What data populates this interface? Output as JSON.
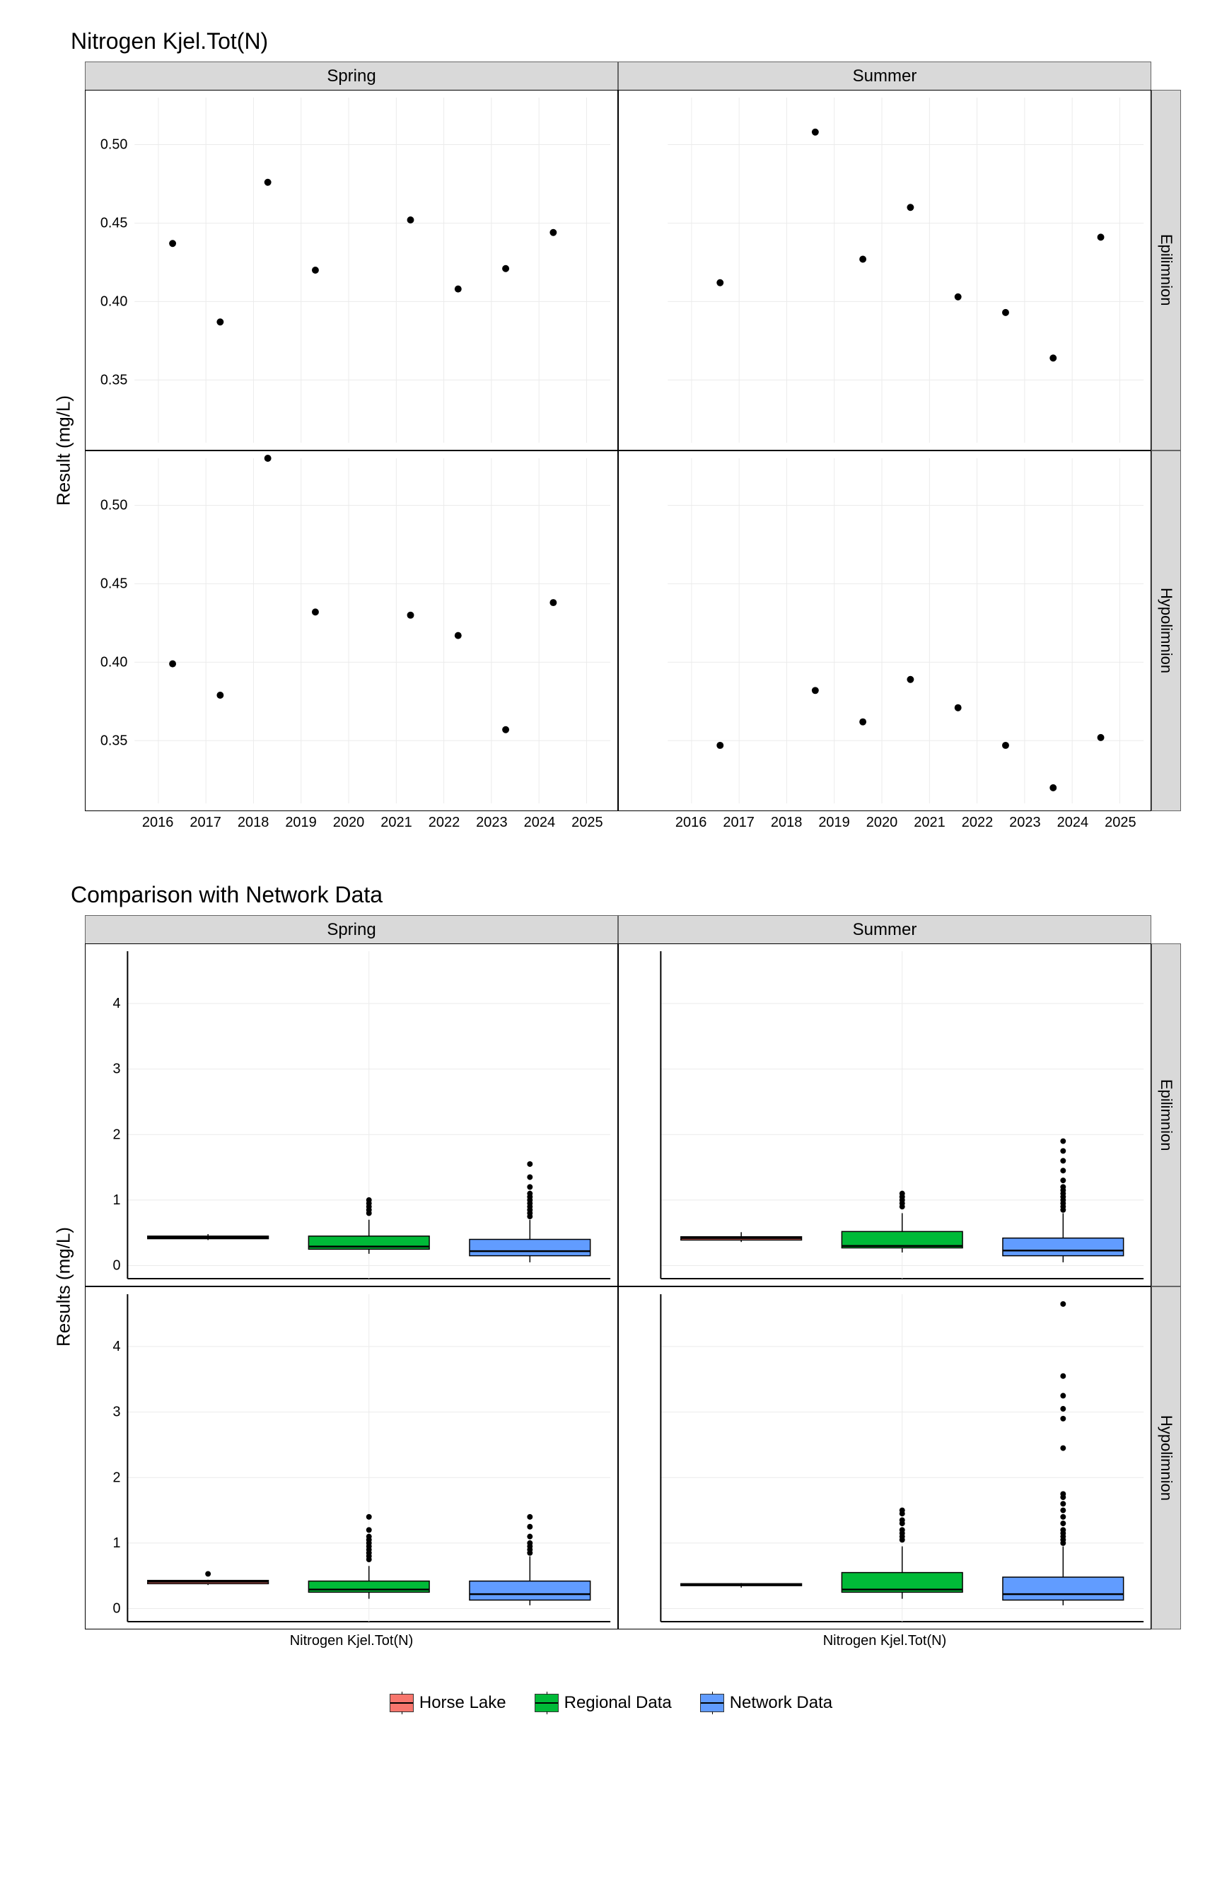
{
  "chart_data": [
    {
      "type": "scatter",
      "title": "Nitrogen Kjel.Tot(N)",
      "ylabel": "Result (mg/L)",
      "xlabel": "",
      "x_range": [
        2015.5,
        2025.5
      ],
      "y_range": [
        0.31,
        0.53
      ],
      "x_ticks": [
        2016,
        2017,
        2018,
        2019,
        2020,
        2021,
        2022,
        2023,
        2024,
        2025
      ],
      "y_ticks": [
        0.35,
        0.4,
        0.45,
        0.5
      ],
      "col_facets": [
        "Spring",
        "Summer"
      ],
      "row_facets": [
        "Epilimnion",
        "Hypolimnion"
      ],
      "panels": {
        "Spring_Epilimnion": [
          {
            "x": 2016.3,
            "y": 0.437
          },
          {
            "x": 2017.3,
            "y": 0.387
          },
          {
            "x": 2018.3,
            "y": 0.476
          },
          {
            "x": 2019.3,
            "y": 0.42
          },
          {
            "x": 2021.3,
            "y": 0.452
          },
          {
            "x": 2022.3,
            "y": 0.408
          },
          {
            "x": 2023.3,
            "y": 0.421
          },
          {
            "x": 2024.3,
            "y": 0.444
          }
        ],
        "Summer_Epilimnion": [
          {
            "x": 2016.6,
            "y": 0.412
          },
          {
            "x": 2018.6,
            "y": 0.508
          },
          {
            "x": 2019.6,
            "y": 0.427
          },
          {
            "x": 2020.6,
            "y": 0.46
          },
          {
            "x": 2021.6,
            "y": 0.403
          },
          {
            "x": 2022.6,
            "y": 0.393
          },
          {
            "x": 2023.6,
            "y": 0.364
          },
          {
            "x": 2024.6,
            "y": 0.441
          }
        ],
        "Spring_Hypolimnion": [
          {
            "x": 2016.3,
            "y": 0.399
          },
          {
            "x": 2017.3,
            "y": 0.379
          },
          {
            "x": 2018.3,
            "y": 0.53
          },
          {
            "x": 2019.3,
            "y": 0.432
          },
          {
            "x": 2021.3,
            "y": 0.43
          },
          {
            "x": 2022.3,
            "y": 0.417
          },
          {
            "x": 2023.3,
            "y": 0.357
          },
          {
            "x": 2024.3,
            "y": 0.438
          }
        ],
        "Summer_Hypolimnion": [
          {
            "x": 2016.6,
            "y": 0.347
          },
          {
            "x": 2018.6,
            "y": 0.382
          },
          {
            "x": 2019.6,
            "y": 0.362
          },
          {
            "x": 2020.6,
            "y": 0.389
          },
          {
            "x": 2021.6,
            "y": 0.371
          },
          {
            "x": 2022.6,
            "y": 0.347
          },
          {
            "x": 2023.6,
            "y": 0.32
          },
          {
            "x": 2024.6,
            "y": 0.352
          }
        ]
      }
    },
    {
      "type": "boxplot",
      "title": "Comparison with Network Data",
      "ylabel": "Results (mg/L)",
      "xlabel": "Nitrogen Kjel.Tot(N)",
      "y_range": [
        -0.2,
        4.8
      ],
      "y_ticks": [
        0,
        1,
        2,
        3,
        4
      ],
      "col_facets": [
        "Spring",
        "Summer"
      ],
      "row_facets": [
        "Epilimnion",
        "Hypolimnion"
      ],
      "groups": [
        "Horse Lake",
        "Regional Data",
        "Network Data"
      ],
      "colors": {
        "Horse Lake": "#F8766D",
        "Regional Data": "#00BA38",
        "Network Data": "#619CFF"
      },
      "panels": {
        "Spring_Epilimnion": {
          "boxes": [
            {
              "g": "Horse Lake",
              "min": 0.39,
              "q1": 0.41,
              "med": 0.43,
              "q3": 0.45,
              "max": 0.48,
              "out": []
            },
            {
              "g": "Regional Data",
              "min": 0.18,
              "q1": 0.25,
              "med": 0.29,
              "q3": 0.45,
              "max": 0.7,
              "out": [
                0.8,
                0.85,
                0.9,
                0.95,
                1.0
              ]
            },
            {
              "g": "Network Data",
              "min": 0.05,
              "q1": 0.15,
              "med": 0.22,
              "q3": 0.4,
              "max": 0.7,
              "out": [
                0.75,
                0.8,
                0.85,
                0.9,
                0.95,
                1.0,
                1.05,
                1.1,
                1.2,
                1.35,
                1.55
              ]
            }
          ]
        },
        "Summer_Epilimnion": {
          "boxes": [
            {
              "g": "Horse Lake",
              "min": 0.36,
              "q1": 0.39,
              "med": 0.42,
              "q3": 0.44,
              "max": 0.51,
              "out": []
            },
            {
              "g": "Regional Data",
              "min": 0.2,
              "q1": 0.27,
              "med": 0.3,
              "q3": 0.52,
              "max": 0.8,
              "out": [
                0.9,
                0.95,
                1.0,
                1.05,
                1.1
              ]
            },
            {
              "g": "Network Data",
              "min": 0.05,
              "q1": 0.15,
              "med": 0.23,
              "q3": 0.42,
              "max": 0.8,
              "out": [
                0.85,
                0.9,
                0.95,
                1.0,
                1.05,
                1.1,
                1.15,
                1.2,
                1.3,
                1.45,
                1.6,
                1.75,
                1.9
              ]
            }
          ]
        },
        "Spring_Hypolimnion": {
          "boxes": [
            {
              "g": "Horse Lake",
              "min": 0.36,
              "q1": 0.38,
              "med": 0.41,
              "q3": 0.43,
              "max": 0.44,
              "out": [
                0.53
              ]
            },
            {
              "g": "Regional Data",
              "min": 0.15,
              "q1": 0.25,
              "med": 0.29,
              "q3": 0.42,
              "max": 0.65,
              "out": [
                0.75,
                0.8,
                0.85,
                0.9,
                0.95,
                1.0,
                1.05,
                1.1,
                1.2,
                1.4
              ]
            },
            {
              "g": "Network Data",
              "min": 0.05,
              "q1": 0.13,
              "med": 0.22,
              "q3": 0.42,
              "max": 0.8,
              "out": [
                0.85,
                0.9,
                0.95,
                1.0,
                1.1,
                1.25,
                1.4
              ]
            }
          ]
        },
        "Summer_Hypolimnion": {
          "boxes": [
            {
              "g": "Horse Lake",
              "min": 0.32,
              "q1": 0.35,
              "med": 0.36,
              "q3": 0.38,
              "max": 0.39,
              "out": []
            },
            {
              "g": "Regional Data",
              "min": 0.15,
              "q1": 0.25,
              "med": 0.29,
              "q3": 0.55,
              "max": 0.95,
              "out": [
                1.05,
                1.1,
                1.15,
                1.2,
                1.3,
                1.35,
                1.45,
                1.5
              ]
            },
            {
              "g": "Network Data",
              "min": 0.05,
              "q1": 0.13,
              "med": 0.22,
              "q3": 0.48,
              "max": 0.95,
              "out": [
                1.0,
                1.05,
                1.1,
                1.15,
                1.2,
                1.3,
                1.4,
                1.5,
                1.6,
                1.7,
                1.75,
                2.45,
                2.9,
                3.05,
                3.25,
                3.55,
                4.65
              ]
            }
          ]
        }
      }
    }
  ],
  "legend": {
    "items": [
      {
        "label": "Horse Lake",
        "color": "#F8766D"
      },
      {
        "label": "Regional Data",
        "color": "#00BA38"
      },
      {
        "label": "Network Data",
        "color": "#619CFF"
      }
    ]
  }
}
